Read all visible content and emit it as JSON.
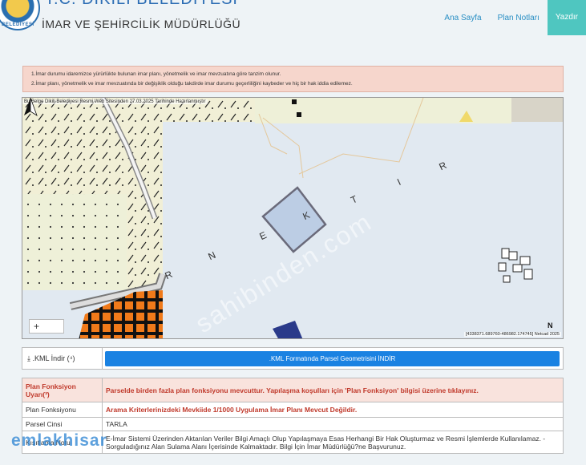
{
  "header": {
    "logo_text": "BELEDİYESİ",
    "title": "T.C. DİKİLİ BELEDİYESİ",
    "subtitle": "İMAR VE ŞEHİRCİLİK MÜDÜRLÜĞÜ",
    "nav": [
      "Ana Sayfa",
      "Plan Notları",
      "Yazdır"
    ]
  },
  "notices": [
    "1.İmar durumu idaremizce yürürlükte bulunan imar planı, yönetmelik ve imar mevzuatına göre tanzim olunur.",
    "2.İmar planı, yönetmelik ve imar mevzuatında bir değişiklik olduğu takdirde imar durumu geçerliliğini kaybeder ve hiç bir hak iddia edilemez."
  ],
  "map": {
    "date_note": "Bu Belge Dikili Belediyesi Resmi Web Sitesinden 27.03.2025 Tarihinde Hazırlanmıştır",
    "zoom_label": "+",
    "coords": "[4338371.689760-486982.174745] Netcad 2025",
    "north_label": "N",
    "labels": [
      "R",
      "N",
      "E",
      "K",
      "T",
      "I",
      "R"
    ],
    "watermark": "sahibinden.com"
  },
  "kml": {
    "label": "⤓ .KML İndir (⁴)",
    "button": ".KML Formatında Parsel Geometrisini İNDİR"
  },
  "info": {
    "rows": [
      {
        "key": "Plan Fonksiyon Uyarı(³)",
        "value": "Parselde birden fazla plan fonksiyonu mevcuttur. Yapılaşma koşulları için 'Plan Fonksiyon' bilgisi üzerine tıklayınız."
      },
      {
        "key": "Plan Fonksiyonu",
        "value": "Arama Kriterlerinizdeki Mevkiide 1/1000 Uygulama İmar Planı Mevcut Değildir."
      },
      {
        "key": "Parsel Cinsi",
        "value": "TARLA"
      },
      {
        "key": "Kısıtlama Notu",
        "value": "E-İmar Sistemi Üzerinden Aktarılan Veriler Bilgi Amaçlı Olup Yapılaşmaya Esas Herhangi Bir Hak Oluşturmaz ve Resmi İşlemlerde Kullanılamaz. -Sorguladığınız Alan Sulama Alanı İçerisinde Kalmaktadır. Bilgi İçin İmar Müdürlüğü?ne Başvurunuz."
      }
    ]
  },
  "footer_logo": "emlakhisar",
  "colors": {
    "accent": "#2a8fc4",
    "print_button": "#4fc6c0",
    "kml_button": "#1a82e2",
    "warning": "#c0392b",
    "notice_bg": "#f6d6cc"
  }
}
